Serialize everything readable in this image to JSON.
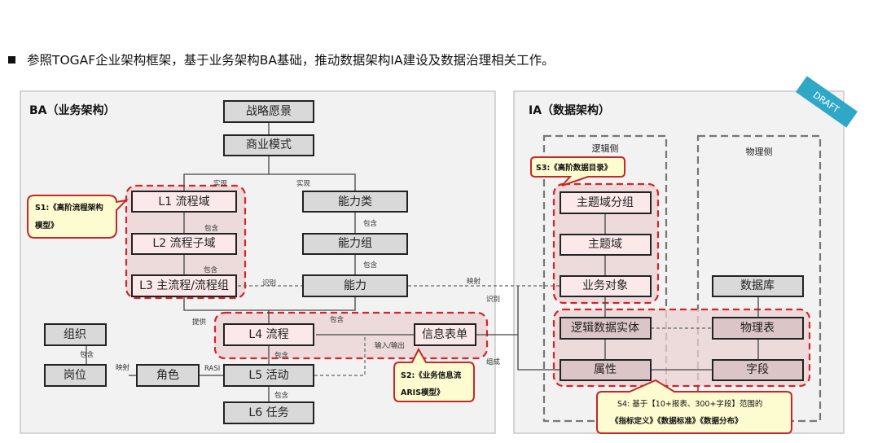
{
  "headline": "参照TOGAF企业架构框架，基于业务架构BA基础，推动数据架构IA建设及数据治理相关工作。",
  "draft_badge": "DRAFT",
  "colors": {
    "panel_bg": "#f2f2f2",
    "grey_box": "#d9d9d9",
    "pink_box": "#fbe9ea",
    "mauve_box": "#dcc5c7",
    "red_dash": "#d0252c",
    "callout_bg": "#fdfbd0",
    "draft_bg": "#2fa8c8"
  },
  "ba": {
    "title": "BA（业务架构）",
    "nodes": {
      "strategy": "战略愿景",
      "business_model": "商业模式",
      "l1": "L1 流程域",
      "l2": "L2 流程子域",
      "l3": "L3 主流程/流程组",
      "capability_class": "能力类",
      "capability_group": "能力组",
      "capability": "能力",
      "l4": "L4 流程",
      "info_form": "信息表单",
      "org": "组织",
      "post": "岗位",
      "role": "角色",
      "l5": "L5 活动",
      "l6": "L6 任务"
    },
    "edge_labels": {
      "realize_left": "实现",
      "realize_right": "实现",
      "contain_l1_l2": "包含",
      "contain_l2_l3": "包含",
      "contain_cc_cg": "包含",
      "contain_cg_c": "包含",
      "identify": "识别",
      "provide": "提供",
      "contain_l4": "包含",
      "io": "输入/输出",
      "contain_l4_l5": "包含",
      "contain_org_post": "包含",
      "map_post_role": "映射",
      "rasi": "RASI",
      "contain_l5_l6": "包含"
    },
    "callouts": {
      "s1_line1": "S1:《高阶流程架构",
      "s1_line2": "模型》",
      "s2_line1": "S2:《业务信息流",
      "s2_line2": "ARIS模型》"
    }
  },
  "cross_labels": {
    "map": "映射",
    "identify": "识别",
    "compose": "组成"
  },
  "ia": {
    "title": "IA（数据架构）",
    "logical_title": "逻辑侧",
    "physical_title": "物理侧",
    "nodes": {
      "subject_group": "主题域分组",
      "subject": "主题域",
      "business_object": "业务对象",
      "logical_entity": "逻辑数据实体",
      "attribute": "属性",
      "database": "数据库",
      "physical_table": "物理表",
      "field": "字段"
    },
    "callouts": {
      "s3": "S3:《高阶数据目录》",
      "s4_line1": "S4: 基于【10+报表、300+字段】范围的",
      "s4_line2": "《指标定义》《数据标准》《数据分布》"
    }
  }
}
